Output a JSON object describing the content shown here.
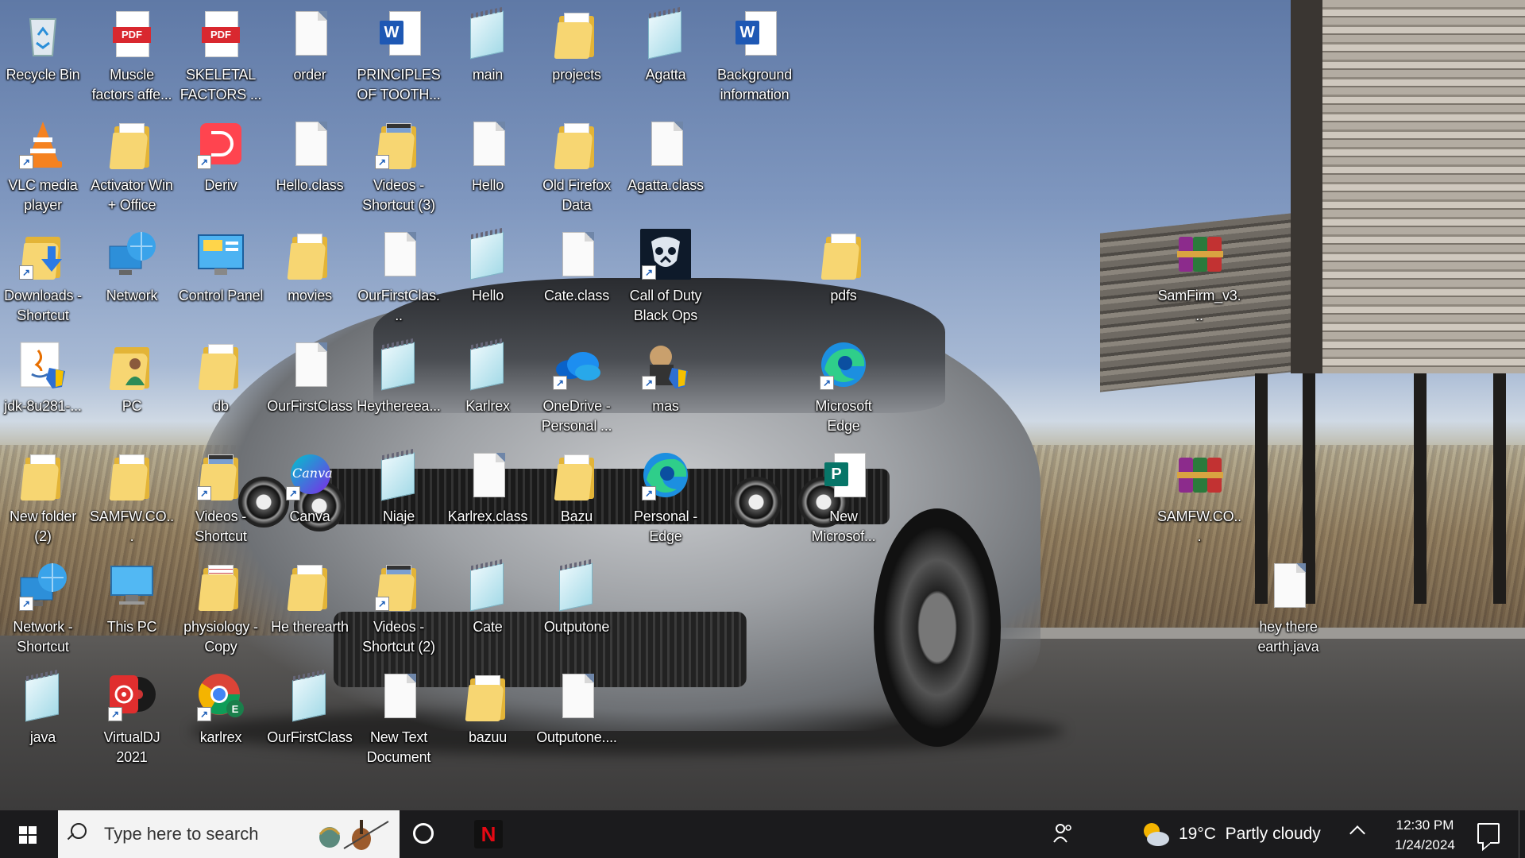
{
  "desktop": {
    "icons": [
      {
        "label": "Recycle Bin",
        "type": "recycle",
        "shortcut": false
      },
      {
        "label": "Muscle factors affe...",
        "type": "pdf",
        "shortcut": false
      },
      {
        "label": "SKELETAL FACTORS ...",
        "type": "pdf",
        "shortcut": false
      },
      {
        "label": "order",
        "type": "file",
        "shortcut": false
      },
      {
        "label": "PRINCIPLES OF TOOTH...",
        "type": "word",
        "shortcut": false
      },
      {
        "label": "main",
        "type": "note",
        "shortcut": false
      },
      {
        "label": "projects",
        "type": "folder",
        "shortcut": false
      },
      {
        "label": "Agatta",
        "type": "note",
        "shortcut": false
      },
      {
        "label": "Background information",
        "type": "word",
        "shortcut": false
      },
      {
        "label": "VLC media player",
        "type": "vlc",
        "shortcut": true
      },
      {
        "label": "Activator Win + Office",
        "type": "folder",
        "shortcut": false
      },
      {
        "label": "Deriv",
        "type": "deriv",
        "shortcut": true
      },
      {
        "label": "Hello.class",
        "type": "file",
        "shortcut": false
      },
      {
        "label": "Videos - Shortcut (3)",
        "type": "videofolder",
        "shortcut": true
      },
      {
        "label": "Hello",
        "type": "file",
        "shortcut": false
      },
      {
        "label": "Old Firefox Data",
        "type": "folder",
        "shortcut": false
      },
      {
        "label": "Agatta.class",
        "type": "file",
        "shortcut": false
      },
      {
        "label": "Downloads - Shortcut",
        "type": "downloads",
        "shortcut": true
      },
      {
        "label": "Network",
        "type": "network",
        "shortcut": false
      },
      {
        "label": "Control Panel",
        "type": "controlpanel",
        "shortcut": false
      },
      {
        "label": "movies",
        "type": "folder",
        "shortcut": false
      },
      {
        "label": "OurFirstClas...",
        "type": "file",
        "shortcut": false
      },
      {
        "label": "Hello",
        "type": "note",
        "shortcut": false
      },
      {
        "label": "Cate.class",
        "type": "file",
        "shortcut": false
      },
      {
        "label": "Call of Duty Black Ops",
        "type": "cod",
        "shortcut": true
      },
      {
        "label": "pdfs",
        "type": "folder",
        "shortcut": false
      },
      {
        "label": "SamFirm_v3...",
        "type": "winrar",
        "shortcut": false
      },
      {
        "label": "jdk-8u281-...",
        "type": "java",
        "shortcut": false
      },
      {
        "label": "PC",
        "type": "userfolder",
        "shortcut": false
      },
      {
        "label": "db",
        "type": "folder",
        "shortcut": false
      },
      {
        "label": "OurFirstClass",
        "type": "file",
        "shortcut": false
      },
      {
        "label": "Heythereea...",
        "type": "note",
        "shortcut": false
      },
      {
        "label": "Karlrex",
        "type": "note",
        "shortcut": false
      },
      {
        "label": "OneDrive - Personal ...",
        "type": "onedrive",
        "shortcut": true
      },
      {
        "label": "mas",
        "type": "mas",
        "shortcut": true
      },
      {
        "label": "Microsoft Edge",
        "type": "edge",
        "shortcut": true
      },
      {
        "label": "New folder (2)",
        "type": "folder",
        "shortcut": false
      },
      {
        "label": "SAMFW.CO...",
        "type": "folder",
        "shortcut": false
      },
      {
        "label": "Videos - Shortcut",
        "type": "videofolder",
        "shortcut": true
      },
      {
        "label": "Canva",
        "type": "canva",
        "shortcut": true
      },
      {
        "label": "Niaje",
        "type": "note",
        "shortcut": false
      },
      {
        "label": "Karlrex.class",
        "type": "file",
        "shortcut": false
      },
      {
        "label": "Bazu",
        "type": "folder",
        "shortcut": false
      },
      {
        "label": "Personal - Edge",
        "type": "edge",
        "shortcut": true
      },
      {
        "label": "New Microsof...",
        "type": "publisher",
        "shortcut": false
      },
      {
        "label": "SAMFW.CO...",
        "type": "winrar",
        "shortcut": false
      },
      {
        "label": "Network - Shortcut",
        "type": "network",
        "shortcut": true
      },
      {
        "label": "This PC",
        "type": "thispc",
        "shortcut": false
      },
      {
        "label": "physiology - Copy",
        "type": "docfolder",
        "shortcut": false
      },
      {
        "label": "He therearth",
        "type": "folder",
        "shortcut": false
      },
      {
        "label": "Videos - Shortcut (2)",
        "type": "videofolder",
        "shortcut": true
      },
      {
        "label": "Cate",
        "type": "note",
        "shortcut": false
      },
      {
        "label": "Outputone",
        "type": "note",
        "shortcut": false
      },
      {
        "label": "hey there earth.java",
        "type": "file",
        "shortcut": false
      },
      {
        "label": "java",
        "type": "note",
        "shortcut": false
      },
      {
        "label": "VirtualDJ 2021",
        "type": "virtualdj",
        "shortcut": true
      },
      {
        "label": "karlrex",
        "type": "chrome",
        "shortcut": true
      },
      {
        "label": "OurFirstClass",
        "type": "note",
        "shortcut": false
      },
      {
        "label": "New Text Document",
        "type": "file",
        "shortcut": false
      },
      {
        "label": "bazuu",
        "type": "folder",
        "shortcut": false
      },
      {
        "label": "Outputone....",
        "type": "file",
        "shortcut": false
      }
    ]
  },
  "taskbar": {
    "search_placeholder": "Type here to search",
    "pinned": [
      {
        "name": "cortana-icon"
      },
      {
        "name": "netflix-icon",
        "glyph": "N"
      }
    ],
    "weather": {
      "temp": "19°C",
      "condition": "Partly cloudy"
    },
    "clock": {
      "time": "12:30 PM",
      "date": "1/24/2024"
    }
  },
  "colors": {
    "taskbar": "#1b1b1d",
    "folder": "#f7d672",
    "pdf": "#d9282f",
    "word": "#1e58b4",
    "accent": "#2b7ae4"
  }
}
